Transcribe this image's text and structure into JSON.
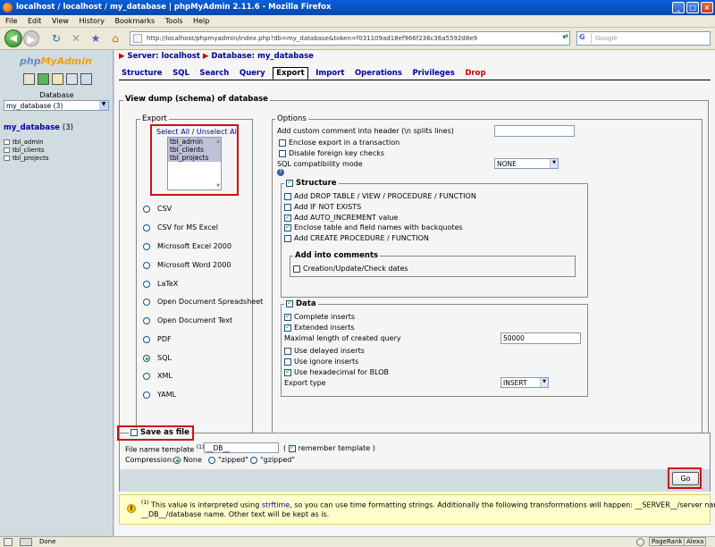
{
  "window": {
    "title": "localhost / localhost / my_database | phpMyAdmin 2.11.6 - Mozilla Firefox"
  },
  "menu": [
    "File",
    "Edit",
    "View",
    "History",
    "Bookmarks",
    "Tools",
    "Help"
  ],
  "nav": {
    "url": "http://localhost/phpmyadmin/index.php?db=my_database&token=f031109ad18ef966f236c36a5592d8e9",
    "search_placeholder": "Google"
  },
  "sidebar": {
    "logo_php": "php",
    "logo_my": "MyAdmin",
    "db_label": "Database",
    "db_selected": "my_database (3)",
    "db_link": "my_database",
    "db_count": "(3)",
    "tables": [
      "tbl_admin",
      "tbl_clients",
      "tbl_projects"
    ]
  },
  "breadcrumb": {
    "server": "Server: localhost",
    "sep": "▶",
    "database": "Database: my_database"
  },
  "tabs": [
    "Structure",
    "SQL",
    "Search",
    "Query",
    "Export",
    "Import",
    "Operations",
    "Privileges",
    "Drop"
  ],
  "active_tab": "Export",
  "dump": {
    "legend": "View dump (schema) of database"
  },
  "export": {
    "legend": "Export",
    "select_all": "Select All",
    "sep": " / ",
    "unselect_all": "Unselect All",
    "tables": [
      "tbl_admin",
      "tbl_clients",
      "tbl_projects"
    ],
    "formats": [
      "CSV",
      "CSV for MS Excel",
      "Microsoft Excel 2000",
      "Microsoft Word 2000",
      "LaTeX",
      "Open Document Spreadsheet",
      "Open Document Text",
      "PDF",
      "SQL",
      "XML",
      "YAML"
    ],
    "selected_format": "SQL"
  },
  "options": {
    "legend": "Options",
    "comment_label": "Add custom comment into header (\\n splits lines)",
    "comment_value": "",
    "enclose_transaction": "Enclose export in a transaction",
    "disable_fk": "Disable foreign key checks",
    "compat_label": "SQL compatibility mode",
    "compat_value": "NONE",
    "help_icon": "?",
    "structure": {
      "legend": "Structure",
      "items": [
        {
          "label": "Add DROP TABLE / VIEW / PROCEDURE / FUNCTION",
          "checked": false
        },
        {
          "label": "Add IF NOT EXISTS",
          "checked": false
        },
        {
          "label": "Add AUTO_INCREMENT value",
          "checked": true
        },
        {
          "label": "Enclose table and field names with backquotes",
          "checked": true
        },
        {
          "label": "Add CREATE PROCEDURE / FUNCTION",
          "checked": false
        }
      ],
      "comments_legend": "Add into comments",
      "comments_item": "Creation/Update/Check dates"
    },
    "data": {
      "legend": "Data",
      "complete_inserts": "Complete inserts",
      "extended_inserts": "Extended inserts",
      "max_length_label": "Maximal length of created query",
      "max_length_value": "50000",
      "delayed": "Use delayed inserts",
      "ignore": "Use ignore inserts",
      "hex": "Use hexadecimal for BLOB",
      "export_type_label": "Export type",
      "export_type_value": "INSERT"
    }
  },
  "save": {
    "legend": "Save as file",
    "template_label": "File name template",
    "template_sup": "(1)",
    "template_colon": ":",
    "template_value": "__DB__",
    "remember_open": "(",
    "remember": "remember template",
    "remember_close": ")",
    "compression_label": "Compression:",
    "none": "None",
    "zipped": "\"zipped\"",
    "gzipped": "\"gzipped\""
  },
  "go": "Go",
  "note": {
    "sup": "(1)",
    "text1": " This value is interpreted using ",
    "link": "strftime",
    "text2": ", so you can use time formatting strings. Additionally the following transformations will happen: __SERVER__/server name,",
    "line2": "__DB__/database name. Other text will be kept as is."
  },
  "status": {
    "text": "Done",
    "pagerank": "PageRank",
    "alexa": "Alexa"
  },
  "colors": {
    "highlight": "#d01010",
    "link": "#0000a0",
    "note_bg": "#ffffcc"
  }
}
